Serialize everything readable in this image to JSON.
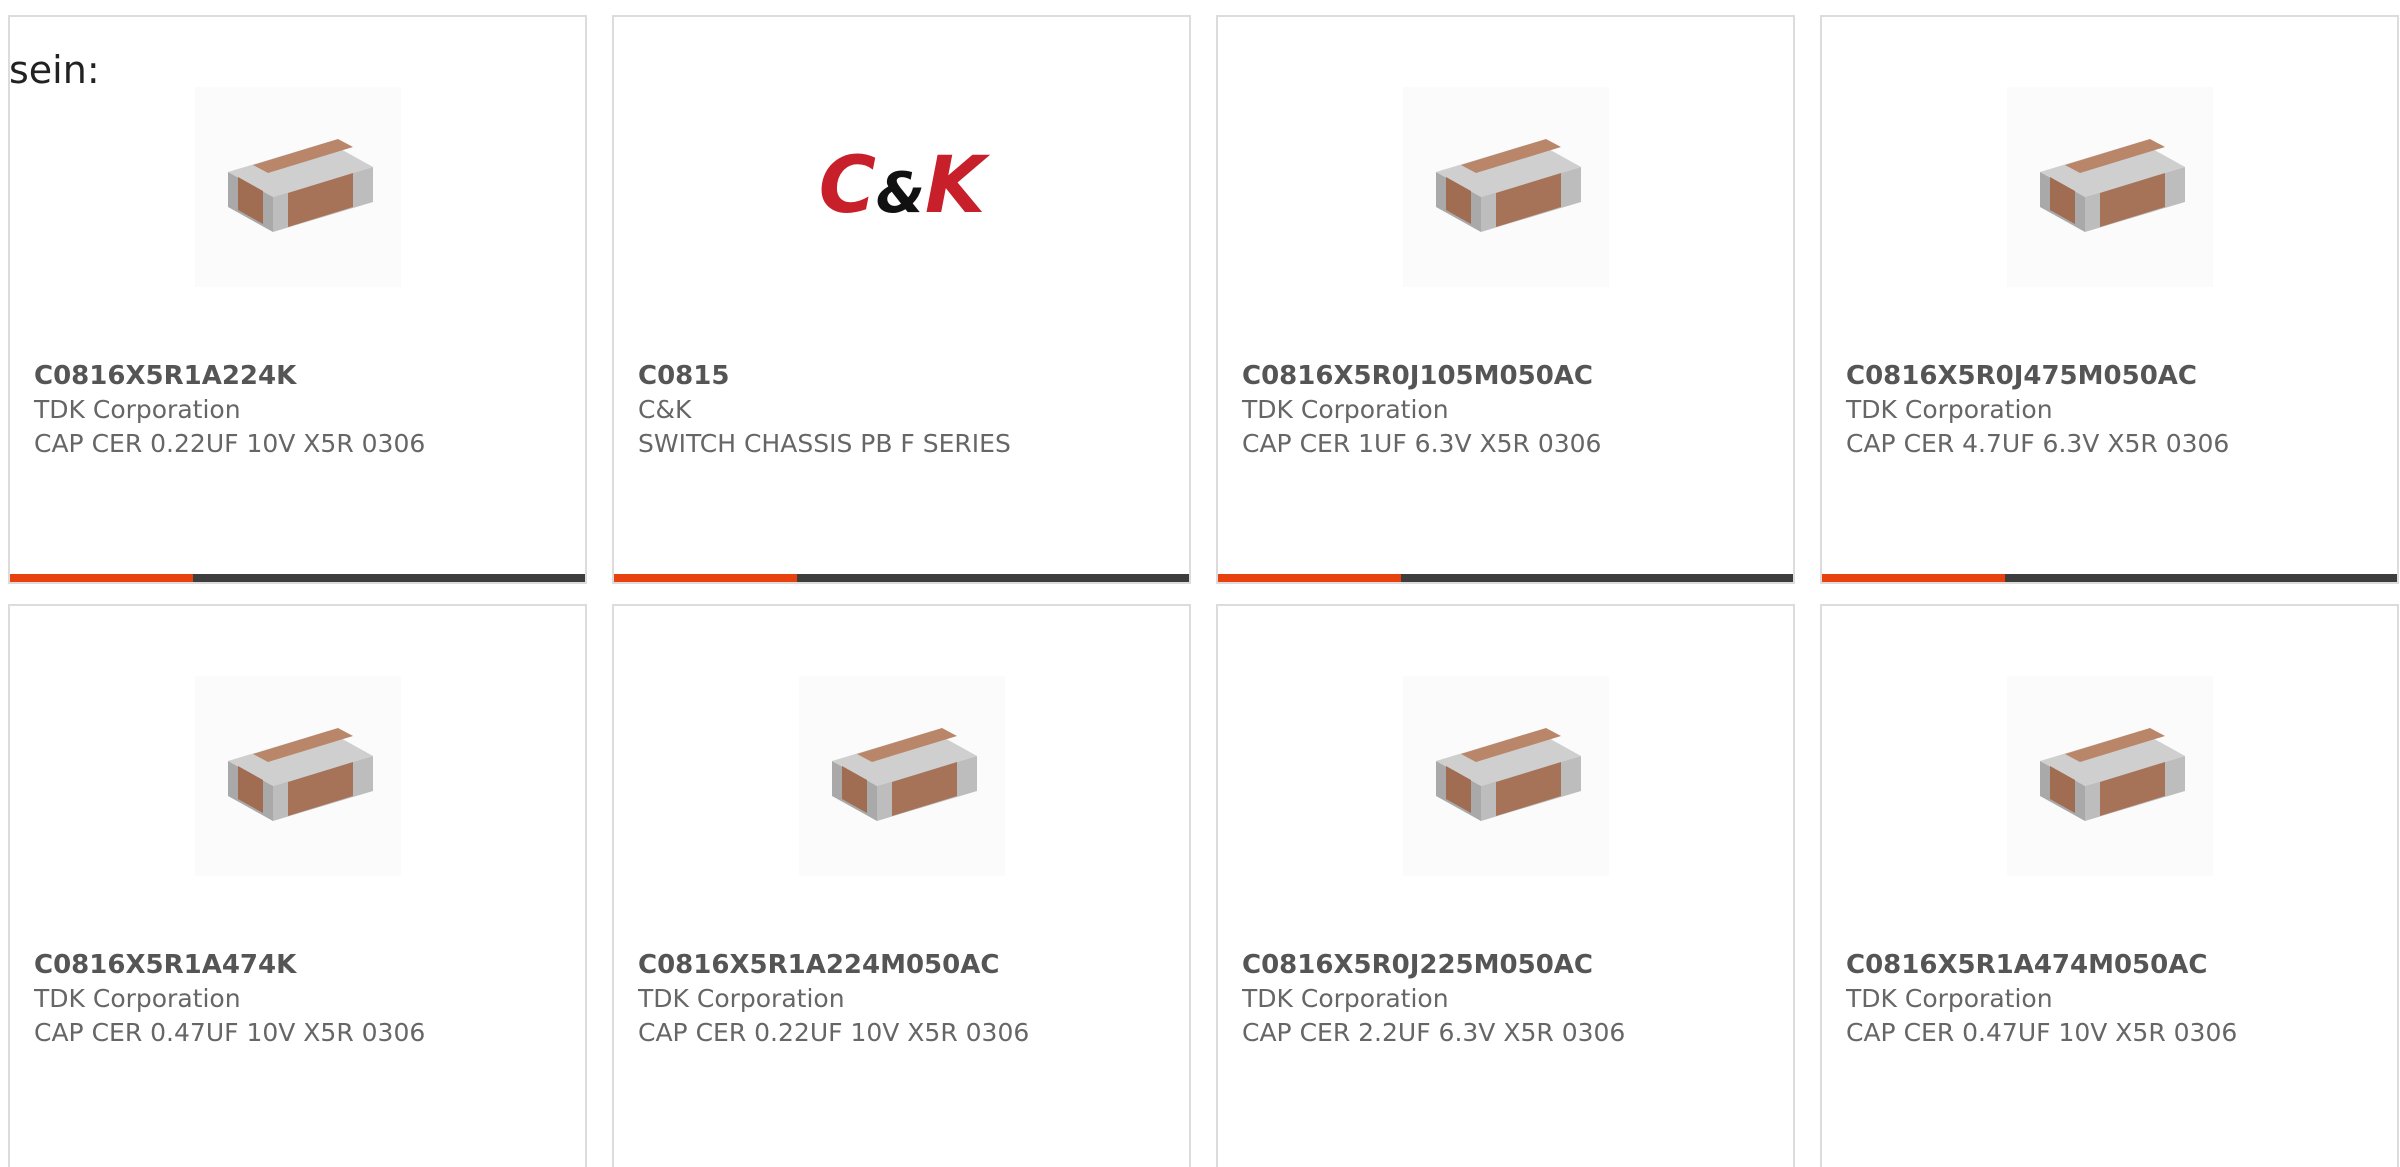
{
  "intro_text": "sein:",
  "colors": {
    "accent": "#e8410f",
    "bar_dark": "#3d3d3d",
    "card_border": "#dcdcdc",
    "logo_red": "#c8202a",
    "logo_black": "#111111"
  },
  "products": [
    {
      "part": "C0816X5R1A224K",
      "maker": "TDK Corporation",
      "desc": "CAP CER 0.22UF 10V X5R 0306",
      "image": "capacitor-chip-image",
      "has_bar": true
    },
    {
      "part": "C0815",
      "maker": "C&K",
      "desc": "SWITCH CHASSIS PB F SERIES",
      "image": "ck-logo-image",
      "logo_text": "C&K",
      "has_bar": true
    },
    {
      "part": "C0816X5R0J105M050AC",
      "maker": "TDK Corporation",
      "desc": "CAP CER 1UF 6.3V X5R 0306",
      "image": "capacitor-chip-image",
      "has_bar": true
    },
    {
      "part": "C0816X5R0J475M050AC",
      "maker": "TDK Corporation",
      "desc": "CAP CER 4.7UF 6.3V X5R 0306",
      "image": "capacitor-chip-image",
      "has_bar": true
    },
    {
      "part": "C0816X5R1A474K",
      "maker": "TDK Corporation",
      "desc": "CAP CER 0.47UF 10V X5R 0306",
      "image": "capacitor-chip-image",
      "has_bar": false
    },
    {
      "part": "C0816X5R1A224M050AC",
      "maker": "TDK Corporation",
      "desc": "CAP CER 0.22UF 10V X5R 0306",
      "image": "capacitor-chip-image",
      "has_bar": false
    },
    {
      "part": "C0816X5R0J225M050AC",
      "maker": "TDK Corporation",
      "desc": "CAP CER 2.2UF 6.3V X5R 0306",
      "image": "capacitor-chip-image",
      "has_bar": false
    },
    {
      "part": "C0816X5R1A474M050AC",
      "maker": "TDK Corporation",
      "desc": "CAP CER 0.47UF 10V X5R 0306",
      "image": "capacitor-chip-image",
      "has_bar": false
    }
  ]
}
